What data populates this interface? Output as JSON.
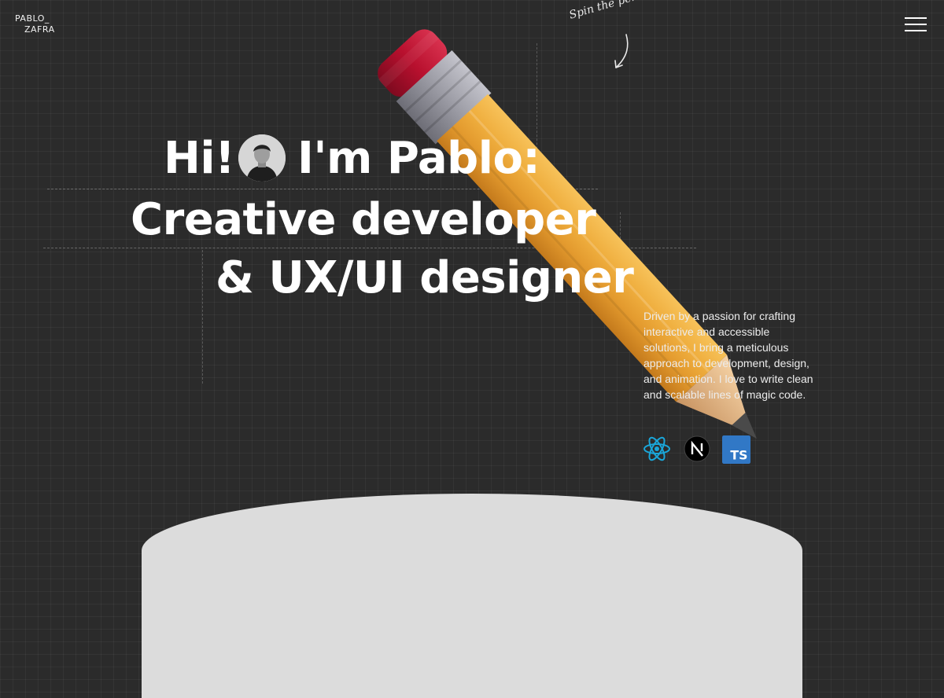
{
  "logo": {
    "line1": "PABLO_",
    "line2": "ZAFRA"
  },
  "menu": {
    "icon": "hamburger-menu-icon"
  },
  "annotation": {
    "text": "Spin the pen!"
  },
  "hero": {
    "line1_part1": "Hi!",
    "line1_part2": "I'm Pablo:",
    "line2": "Creative developer",
    "line3": "& UX/UI designer"
  },
  "description": "Driven by a passion for crafting interactive and accessible solutions, I bring a meticulous approach to development, design, and animation. I love to write clean and scalable lines of magic code.",
  "tech_stack": [
    {
      "name": "react-icon",
      "color": "#1aa6d9"
    },
    {
      "name": "nextjs-icon",
      "color": "#000000"
    },
    {
      "name": "typescript-icon",
      "color": "#3178c6",
      "label": "TS"
    }
  ],
  "colors": {
    "background": "#2b2b2b",
    "pencil_body": "#e8a43a",
    "pencil_eraser": "#b8102e",
    "pencil_ferrule": "#9a9aa3"
  }
}
